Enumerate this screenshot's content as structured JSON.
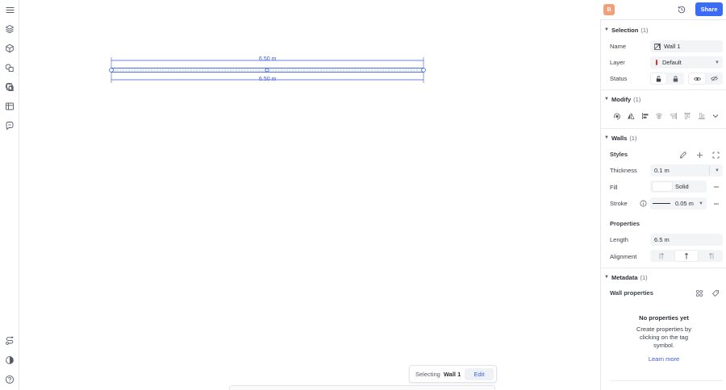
{
  "topbar": {
    "avatar_letter": "B",
    "share_label": "Share"
  },
  "canvas": {
    "dim_top": "6.50 m",
    "dim_bottom": "6.50 m"
  },
  "selection_pill": {
    "label": "Selecting",
    "object": "Wall 1",
    "edit_label": "Edit"
  },
  "panel": {
    "selection": {
      "title": "Selection",
      "count": "(1)",
      "name_label": "Name",
      "name_value": "Wall 1",
      "layer_label": "Layer",
      "layer_value": "Default",
      "status_label": "Status"
    },
    "modify": {
      "title": "Modify",
      "count": "(1)"
    },
    "walls": {
      "title": "Walls",
      "count": "(1)",
      "styles_label": "Styles",
      "thickness_label": "Thickness",
      "thickness_value": "0.1 m",
      "fill_label": "Fill",
      "fill_value": "Solid",
      "stroke_label": "Stroke",
      "stroke_value": "0.05 m",
      "properties_label": "Properties",
      "length_label": "Length",
      "length_value": "6.5 m",
      "alignment_label": "Alignment"
    },
    "metadata": {
      "title": "Metadata",
      "count": "(1)",
      "wall_properties_label": "Wall properties",
      "empty_title": "No properties yet",
      "empty_line1": "Create properties by",
      "empty_line2": "clicking on the tag",
      "empty_line3": "symbol.",
      "learn_more": "Learn more"
    }
  },
  "colors": {
    "accent": "#3b6cf5",
    "wall_stroke": "#3b5bdb",
    "layer_marker": "#e03131",
    "avatar": "#f0a17a"
  }
}
